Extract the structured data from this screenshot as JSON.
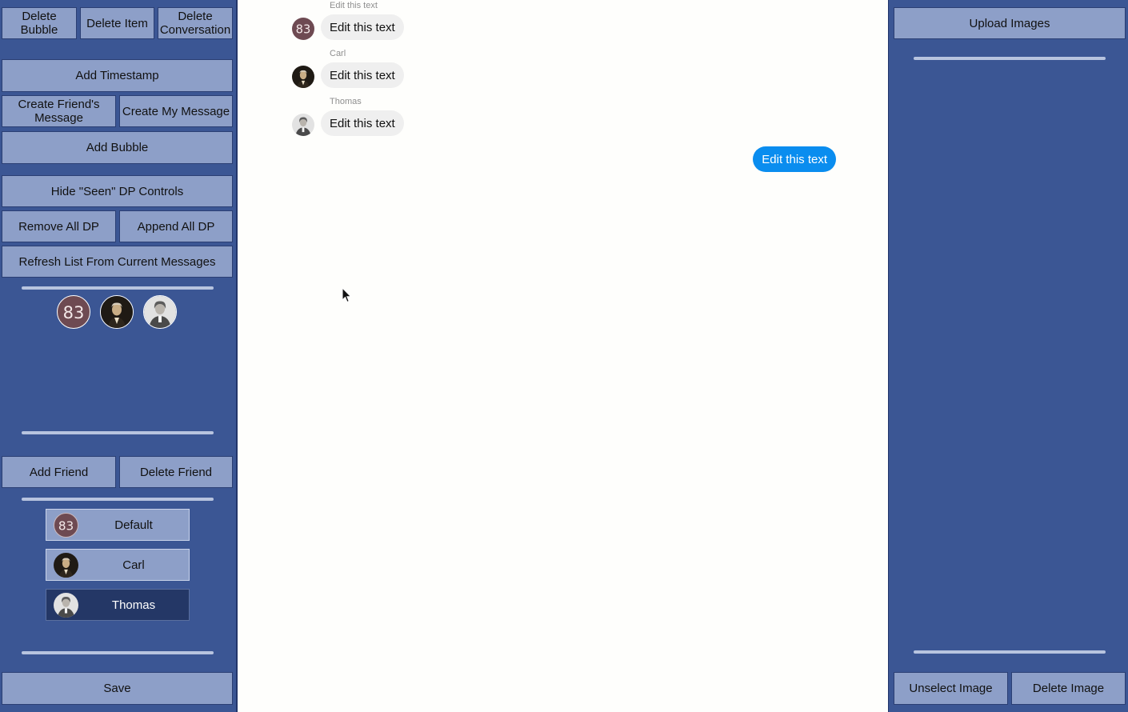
{
  "left_panel": {
    "delete_bubble": "Delete Bubble",
    "delete_item": "Delete Item",
    "delete_conversation": "Delete Conversation",
    "add_timestamp": "Add Timestamp",
    "create_friends_message": "Create Friend's Message",
    "create_my_message": "Create My Message",
    "add_bubble": "Add Bubble",
    "hide_seen_dp": "Hide \"Seen\" DP Controls",
    "remove_all_dp": "Remove All DP",
    "append_all_dp": "Append All DP",
    "refresh_list": "Refresh List From Current Messages",
    "seen_dp": [
      {
        "name": "default-avatar",
        "text": "83"
      },
      {
        "name": "carl-avatar"
      },
      {
        "name": "thomas-avatar"
      }
    ],
    "add_friend": "Add Friend",
    "delete_friend": "Delete Friend",
    "friends": [
      {
        "label": "Default",
        "avatar": "83",
        "selected": false
      },
      {
        "label": "Carl",
        "selected": false
      },
      {
        "label": "Thomas",
        "selected": true
      }
    ],
    "save": "Save"
  },
  "chat": {
    "messages": [
      {
        "sender": "Edit this text",
        "avatar": "83",
        "text": "Edit this text",
        "from": "friend"
      },
      {
        "sender": "Carl",
        "text": "Edit this text",
        "from": "friend"
      },
      {
        "sender": "Thomas",
        "text": "Edit this text",
        "from": "friend"
      },
      {
        "text": "Edit this text",
        "from": "me"
      }
    ]
  },
  "right_panel": {
    "upload_images": "Upload Images",
    "unselect_image": "Unselect Image",
    "delete_image": "Delete Image"
  },
  "colors": {
    "panel": "#3b5694",
    "button": "#8d9fc8",
    "my_bubble": "#0a8def",
    "friend_bubble": "#efefef",
    "default_avatar": "#6e4a52",
    "selected_friend": "#243766"
  }
}
